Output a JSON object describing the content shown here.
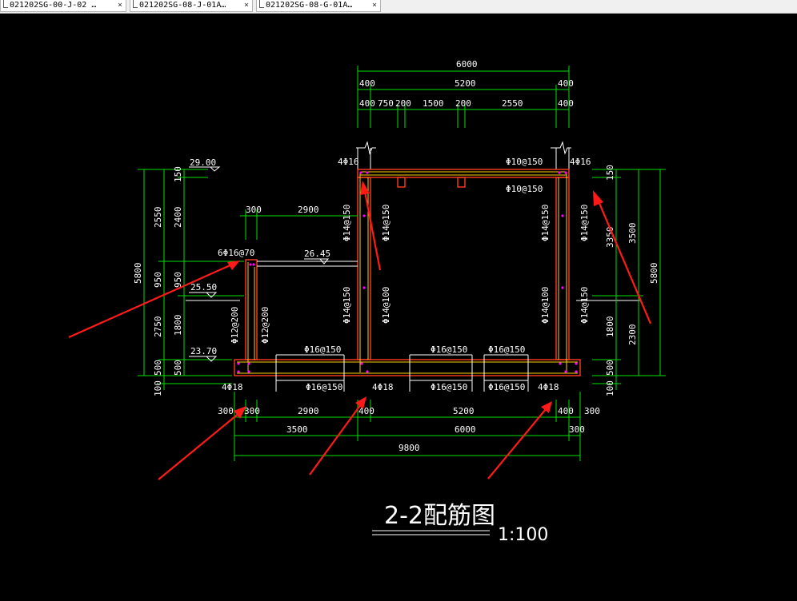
{
  "tabs": [
    {
      "label": "021202SG-00-J-02 …",
      "close": "×"
    },
    {
      "label": "021202SG-08-J-01A…",
      "close": "×"
    },
    {
      "label": "021202SG-08-G-01A…",
      "close": "×"
    }
  ],
  "colors": {
    "dimension": "#00e000",
    "wall": "#ff3b1f",
    "rebar": "#ffd400",
    "annotation_arrow": "#ff1a1a",
    "canvas": "#000000"
  },
  "drawing": {
    "title": "2-2配筋图",
    "scale": "1:100",
    "top_dims": {
      "overall": "6000",
      "row2": [
        "400",
        "5200",
        "400"
      ],
      "row3": [
        "400",
        "750",
        "200",
        "1500",
        "200",
        "2550",
        "400"
      ]
    },
    "bottom_dims": {
      "row1": [
        "300",
        "300",
        "2900",
        "400",
        "5200",
        "400",
        "300"
      ],
      "row2": [
        "3500",
        "6000",
        "300"
      ],
      "overall": "9800"
    },
    "left_dims": {
      "outer": "5800",
      "mid": [
        "2550",
        "950",
        "2750",
        "500",
        "100"
      ],
      "inner": [
        "150",
        "2400",
        "950",
        "1800",
        "500"
      ]
    },
    "right_dims": {
      "inner": [
        "150",
        "3350",
        "1800",
        "500",
        "100"
      ],
      "mid": [
        "3500",
        "2300"
      ],
      "outer": "5800"
    },
    "elevations": [
      "29.00",
      "26.45",
      "25.50",
      "23.70"
    ],
    "span_labels": [
      "300",
      "2900"
    ],
    "rebar_labels": {
      "top_left_corner": "4Φ16",
      "top_right_corner": "4Φ16",
      "roof_top": "Φ10@150",
      "roof_bottom": "Φ10@150",
      "small_roof_corner": "6Φ16@70",
      "wall_mid_upper_l": "Φ14@150",
      "wall_mid_upper_r": "Φ14@150",
      "wall_mid_lower_l": "Φ14@150",
      "wall_mid_lower_r": "Φ14@100",
      "wall_right_upper_l": "Φ14@150",
      "wall_right_upper_r": "Φ14@150",
      "wall_right_lower_l": "Φ14@100",
      "wall_right_lower_r": "Φ14@150",
      "wall_left_l": "Φ12@200",
      "wall_left_r": "Φ12@200",
      "base_top_1": "Φ16@150",
      "base_top_2": "Φ16@150",
      "base_top_3": "Φ16@150",
      "base_bot_1": "Φ16@150",
      "base_bot_2": "Φ16@150",
      "base_bot_3": "Φ16@150",
      "corner_bl": "4Φ18",
      "corner_bm": "4Φ18",
      "corner_br": "4Φ18"
    }
  }
}
